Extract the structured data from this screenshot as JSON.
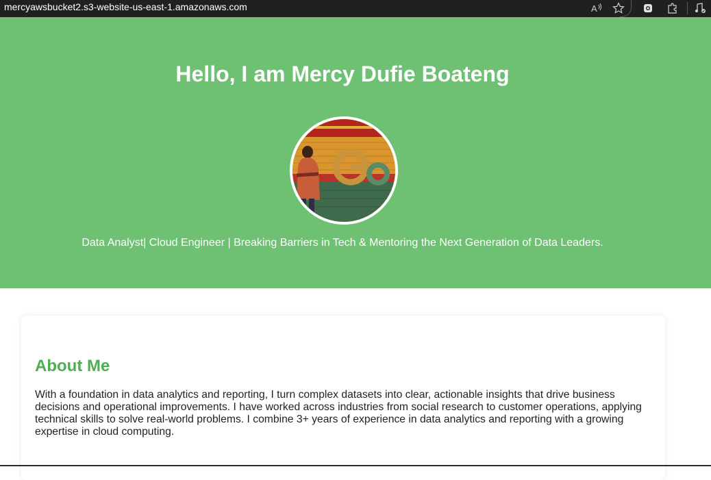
{
  "browser": {
    "url": "mercyawsbucket2.s3-website-us-east-1.amazonaws.com",
    "icons": [
      "read-aloud-icon",
      "favorite-star-icon",
      "extension-icon",
      "extensions-puzzle-icon",
      "media-control-icon"
    ]
  },
  "hero": {
    "title": "Hello, I am Mercy Dufie Boateng",
    "subtitle": "Data Analyst| Cloud Engineer | Breaking Barriers in Tech & Mentoring the Next Generation of Data Leaders.",
    "background_color": "#6ec072"
  },
  "about": {
    "heading": "About Me",
    "heading_color": "#4caf50",
    "text": "With a foundation in data analytics and reporting, I turn complex datasets into clear, actionable insights that drive business decisions and operational improvements. I have worked across industries from social research to customer operations, applying technical skills to solve real-world problems. I combine 3+ years of experience in data analytics and reporting with a growing expertise in cloud computing."
  }
}
